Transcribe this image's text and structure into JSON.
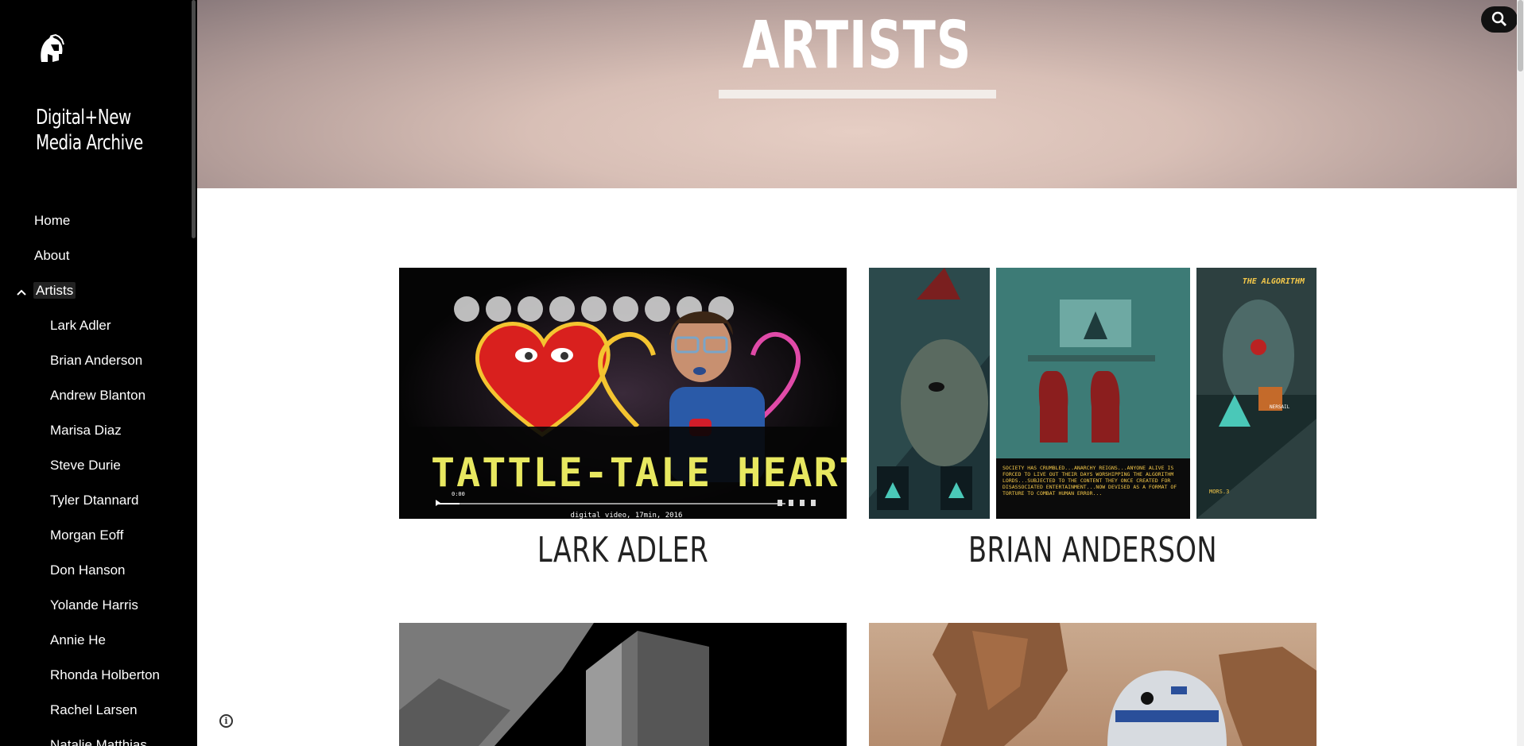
{
  "site": {
    "title_line1": "Digital+New",
    "title_line2": "Media Archive"
  },
  "nav": {
    "home": "Home",
    "about": "About",
    "artists": "Artists",
    "artist_items": [
      "Lark Adler",
      "Brian Anderson",
      "Andrew Blanton",
      "Marisa Diaz",
      "Steve Durie",
      "Tyler Dtannard",
      "Morgan Eoff",
      "Don Hanson",
      "Yolande Harris",
      "Annie He",
      "Rhonda Holberton",
      "Rachel Larsen",
      "Natalie Matthias"
    ]
  },
  "header": {
    "title": "ARTISTS"
  },
  "cards": [
    {
      "name": "LARK ADLER",
      "marquee": "TATTLE-TALE HEART",
      "caption": "digital video, 17min, 2016",
      "time": "0:00"
    },
    {
      "name": "BRIAN ANDERSON",
      "panel_text": "SOCIETY HAS CRUMBLED...ANARCHY REIGNS...ANYONE ALIVE IS FORCED TO LIVE OUT THEIR DAYS WORSHIPPING THE ALGORITHM LORDS...SUBJECTED TO THE CONTENT THEY ONCE CREATED FOR DISASSOCIATED ENTERTAINMENT...NOW DEVISED AS A FORMAT OF TORTURE TO COMBAT HUMAN ERROR...",
      "panel_title": "THE ALGORITHM",
      "label_a": "NERSAIL",
      "label_b": "MORS.3"
    },
    {
      "name": ""
    },
    {
      "name": ""
    }
  ],
  "colors": {
    "sidebar_bg": "#000000",
    "accent_text": "#222222"
  }
}
